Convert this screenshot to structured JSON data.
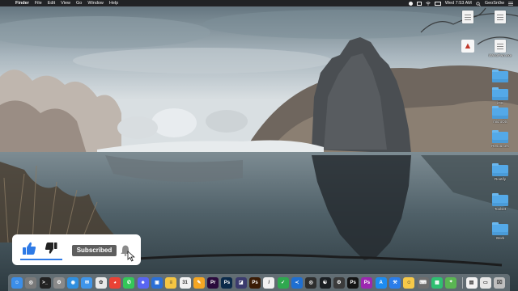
{
  "menubar": {
    "apple_glyph": "",
    "app_name": "Finder",
    "menus": [
      "File",
      "Edit",
      "View",
      "Go",
      "Window",
      "Help"
    ],
    "clock": "Wed 7:53 AM",
    "user": "GeoSn0w",
    "status_icons": [
      "airplay-icon",
      "wifi-icon",
      "battery-icon",
      "display-icon"
    ]
  },
  "desktop": {
    "icons": [
      {
        "name": "document-icon",
        "label": ""
      },
      {
        "name": "document-icon",
        "label": ""
      },
      {
        "name": "app-icon",
        "label": ""
      },
      {
        "name": "document-icon",
        "label": "iWinoPwn.exe"
      },
      {
        "name": "folder-icon",
        "label": ""
      },
      {
        "name": "folder-icon",
        "label": "iOS"
      },
      {
        "name": "folder-icon",
        "label": "microOS"
      },
      {
        "name": "folder-icon",
        "label": "Resources"
      },
      {
        "name": "folder-icon",
        "label": "Rootify"
      },
      {
        "name": "folder-icon",
        "label": "Toolset"
      },
      {
        "name": "folder-icon",
        "label": "Work"
      }
    ]
  },
  "overlay": {
    "subscribe_label": "Subscribed",
    "like_icon": "thumbs-up-icon",
    "dislike_icon": "thumbs-down-icon",
    "bell_icon": "bell-icon",
    "colors": {
      "like": "#2e7ae6",
      "button": "#5e5e5e"
    }
  },
  "dock": {
    "apps": [
      {
        "name": "finder-icon",
        "color": "#3c8ee8",
        "glyph": "☺"
      },
      {
        "name": "launchpad-icon",
        "color": "#7a7a7a",
        "glyph": "◎"
      },
      {
        "name": "terminal-icon",
        "color": "#222222",
        "glyph": ">_"
      },
      {
        "name": "system-prefs-icon",
        "color": "#8a8a8a",
        "glyph": "⚙"
      },
      {
        "name": "safari-icon",
        "color": "#2f8fe0",
        "glyph": "◉"
      },
      {
        "name": "mail-icon",
        "color": "#3f95ea",
        "glyph": "✉"
      },
      {
        "name": "photos-icon",
        "color": "#e9e9e9",
        "glyph": "✿"
      },
      {
        "name": "chrome-icon",
        "color": "#e94235",
        "glyph": "◕"
      },
      {
        "name": "messages-icon",
        "color": "#34c759",
        "glyph": "✆"
      },
      {
        "name": "discord-icon",
        "color": "#5865f2",
        "glyph": "☻"
      },
      {
        "name": "finder-alt-icon",
        "color": "#2b6fd6",
        "glyph": "▣"
      },
      {
        "name": "notes-icon",
        "color": "#f4c542",
        "glyph": "≡"
      },
      {
        "name": "calendar-icon",
        "color": "#f2f2f2",
        "glyph": "31"
      },
      {
        "name": "pages-icon",
        "color": "#f5a623",
        "glyph": "✎"
      },
      {
        "name": "premiere-icon",
        "color": "#2a0a3c",
        "glyph": "Pr"
      },
      {
        "name": "photoshop-icon",
        "color": "#0b2a4a",
        "glyph": "Ps"
      },
      {
        "name": "camera-icon",
        "color": "#3b3b6e",
        "glyph": "◪"
      },
      {
        "name": "illustrator-icon",
        "color": "#3a1c05",
        "glyph": "Ps"
      },
      {
        "name": "script-icon",
        "color": "#f0f0f0",
        "glyph": "/"
      },
      {
        "name": "dreamweaver-icon",
        "color": "#2fa84f",
        "glyph": "✓"
      },
      {
        "name": "vscode-icon",
        "color": "#1f6fd1",
        "glyph": "≺"
      },
      {
        "name": "compass-icon",
        "color": "#2e2e2e",
        "glyph": "◎"
      },
      {
        "name": "github-icon",
        "color": "#1b1f23",
        "glyph": "☯"
      },
      {
        "name": "hex-editor-icon",
        "color": "#3b3b3b",
        "glyph": "⚙"
      },
      {
        "name": "photoshop-alt-icon",
        "color": "#141414",
        "glyph": "Ps"
      },
      {
        "name": "sublime-icon",
        "color": "#9c27b0",
        "glyph": "Ps"
      },
      {
        "name": "appstore-icon",
        "color": "#1d8cf0",
        "glyph": "A"
      },
      {
        "name": "xcode-icon",
        "color": "#2b7de9",
        "glyph": "⚒"
      },
      {
        "name": "emoji-icon",
        "color": "#f7c948",
        "glyph": "☺"
      },
      {
        "name": "keyboard-icon",
        "color": "#6e6e6e",
        "glyph": "⌨"
      },
      {
        "name": "numbers-icon",
        "color": "#2fbf71",
        "glyph": "▦"
      },
      {
        "name": "maps-icon",
        "color": "#5ab552",
        "glyph": "⌖"
      },
      {
        "name": "document-icon",
        "color": "#f2f2f2",
        "glyph": "▤"
      },
      {
        "name": "window-icon",
        "color": "#e6e6e6",
        "glyph": "▭"
      },
      {
        "name": "trash-icon",
        "color": "#bfbfbf",
        "glyph": "⌧"
      }
    ]
  }
}
